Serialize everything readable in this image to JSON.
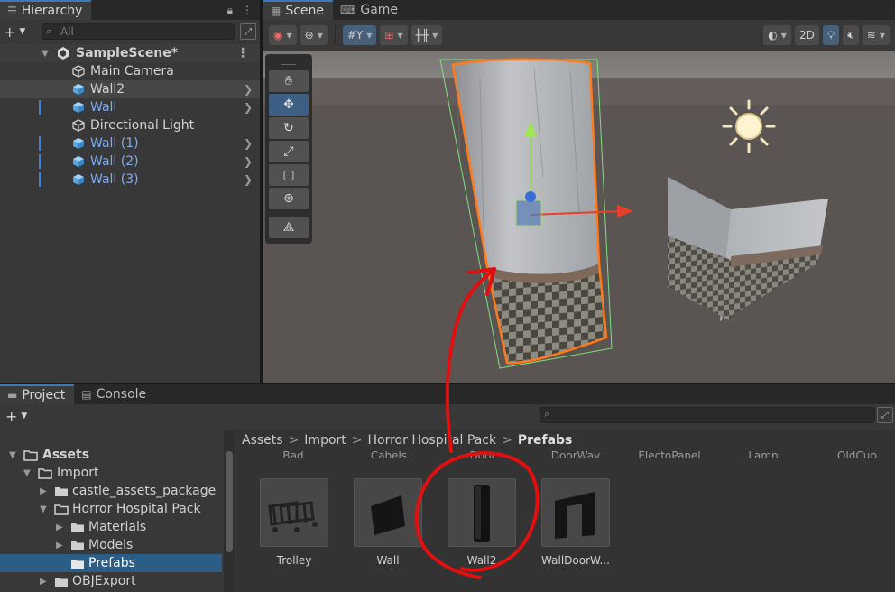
{
  "hierarchy": {
    "tab_label": "Hierarchy",
    "search_placeholder": "All",
    "scene_name": "SampleScene*",
    "items": [
      {
        "label": "Main Camera",
        "type": "camera"
      },
      {
        "label": "Wall2",
        "type": "prefab"
      },
      {
        "label": "Wall",
        "type": "prefab"
      },
      {
        "label": "Directional Light",
        "type": "light"
      },
      {
        "label": "Wall (1)",
        "type": "prefab"
      },
      {
        "label": "Wall (2)",
        "type": "prefab"
      },
      {
        "label": "Wall (3)",
        "type": "prefab"
      }
    ]
  },
  "scene": {
    "tabs": [
      {
        "label": "Scene",
        "icon": "grid-icon"
      },
      {
        "label": "Game",
        "icon": "gamepad-icon"
      }
    ],
    "toolbar": {
      "mode_2d": "2D"
    }
  },
  "project": {
    "tabs": [
      {
        "label": "Project",
        "icon": "folder-icon"
      },
      {
        "label": "Console",
        "icon": "console-icon"
      }
    ],
    "tree": [
      {
        "label": "Assets"
      },
      {
        "label": "Import"
      },
      {
        "label": "castle_assets_package"
      },
      {
        "label": "Horror Hospital Pack"
      },
      {
        "label": "Materials"
      },
      {
        "label": "Models"
      },
      {
        "label": "Prefabs"
      },
      {
        "label": "OBJExport"
      }
    ],
    "breadcrumb": [
      "Assets",
      "Import",
      "Horror Hospital Pack",
      "Prefabs"
    ],
    "partial_row_labels": [
      "Bad",
      "Cabels",
      "Door",
      "DoorWay",
      "ElectoPanel",
      "Lamp",
      "OldCup"
    ],
    "assets": [
      {
        "label": "Trolley"
      },
      {
        "label": "Wall"
      },
      {
        "label": "Wall2"
      },
      {
        "label": "WallDoorW..."
      }
    ]
  },
  "colors": {
    "accent": "#3a79bb",
    "selection": "#2c5d87",
    "annotation": "#e01010",
    "prefab_blue": "#7cacf6"
  }
}
